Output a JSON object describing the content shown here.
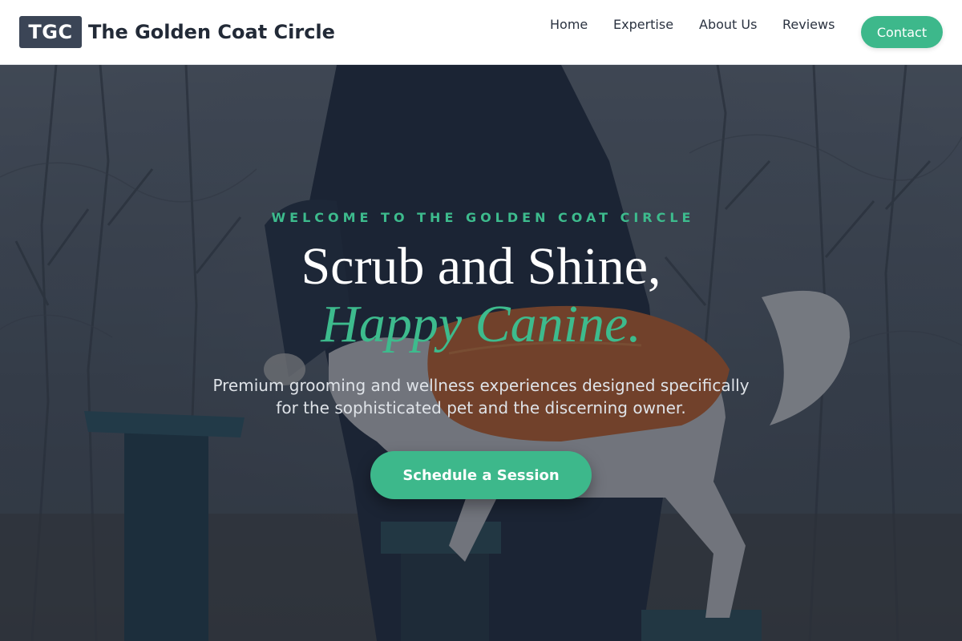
{
  "header": {
    "logo_mark": "TGC",
    "brand_name": "The Golden Coat Circle",
    "nav": [
      {
        "label": "Home"
      },
      {
        "label": "Expertise"
      },
      {
        "label": "About Us"
      },
      {
        "label": "Reviews"
      }
    ],
    "contact_label": "Contact"
  },
  "hero": {
    "eyebrow": "WELCOME TO THE GOLDEN COAT CIRCLE",
    "headline_line1": "Scrub and Shine,",
    "headline_line2": "Happy Canine.",
    "subtitle": "Premium grooming and wellness experiences designed specifically for the sophisticated pet and the discerning owner.",
    "cta_label": "Schedule a Session",
    "background_image": "person-training-dog-in-orange-vest-photo"
  },
  "colors": {
    "accent": "#3db88b",
    "logo_bg": "#3b4556",
    "header_bg": "#ffffff",
    "overlay": "#1c2534"
  }
}
